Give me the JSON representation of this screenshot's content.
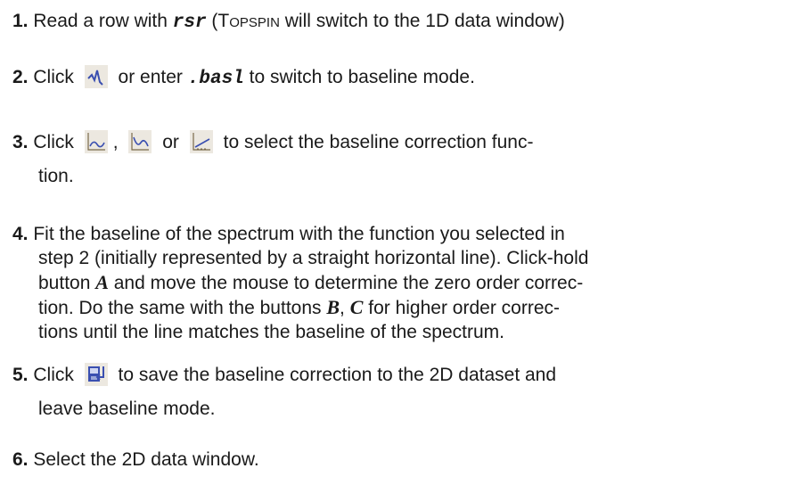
{
  "steps": [
    {
      "num": "1.",
      "t1": "Read a row with ",
      "code": "rsr",
      "t2": " (T",
      "smallcaps": "OPSPIN",
      "t3": " will switch to the 1D data window)"
    },
    {
      "num": "2.",
      "t1": "Click",
      "t2": "or enter ",
      "code": ".basl",
      "t3": " to switch to baseline mode.",
      "icon": "baseline-mode-icon"
    },
    {
      "num": "3.",
      "t1": "Click",
      "sep1": ",",
      "sep2": "or",
      "t2": "to select the baseline correction func-",
      "t3": "tion.",
      "icons": [
        "polynomial-baseline-icon",
        "exponential-baseline-icon",
        "sine-baseline-icon"
      ]
    },
    {
      "num": "4.",
      "lines": [
        "Fit the baseline of the spectrum with the function you selected in",
        "step 2 (initially represented by a straight horizontal line). Click-hold",
        "tion. Do the same with the buttons ",
        "tions until the line matches the baseline of the spectrum."
      ],
      "l3a": "button ",
      "A": "A",
      "l3b": " and move the mouse to determine the zero order correc-",
      "B": "B",
      "comma": ", ",
      "C": "C",
      "l4b": " for higher order correc-"
    },
    {
      "num": "5.",
      "t1": "Click",
      "t2": "to save the baseline correction to the 2D dataset and",
      "t3": "leave baseline mode.",
      "icon": "save-return-icon"
    },
    {
      "num": "6.",
      "t1": "Select the 2D data window."
    }
  ],
  "colors": {
    "text": "#1a1a1a",
    "icon_bg": "#e9e4db",
    "icon_blue": "#3a4fb0"
  }
}
